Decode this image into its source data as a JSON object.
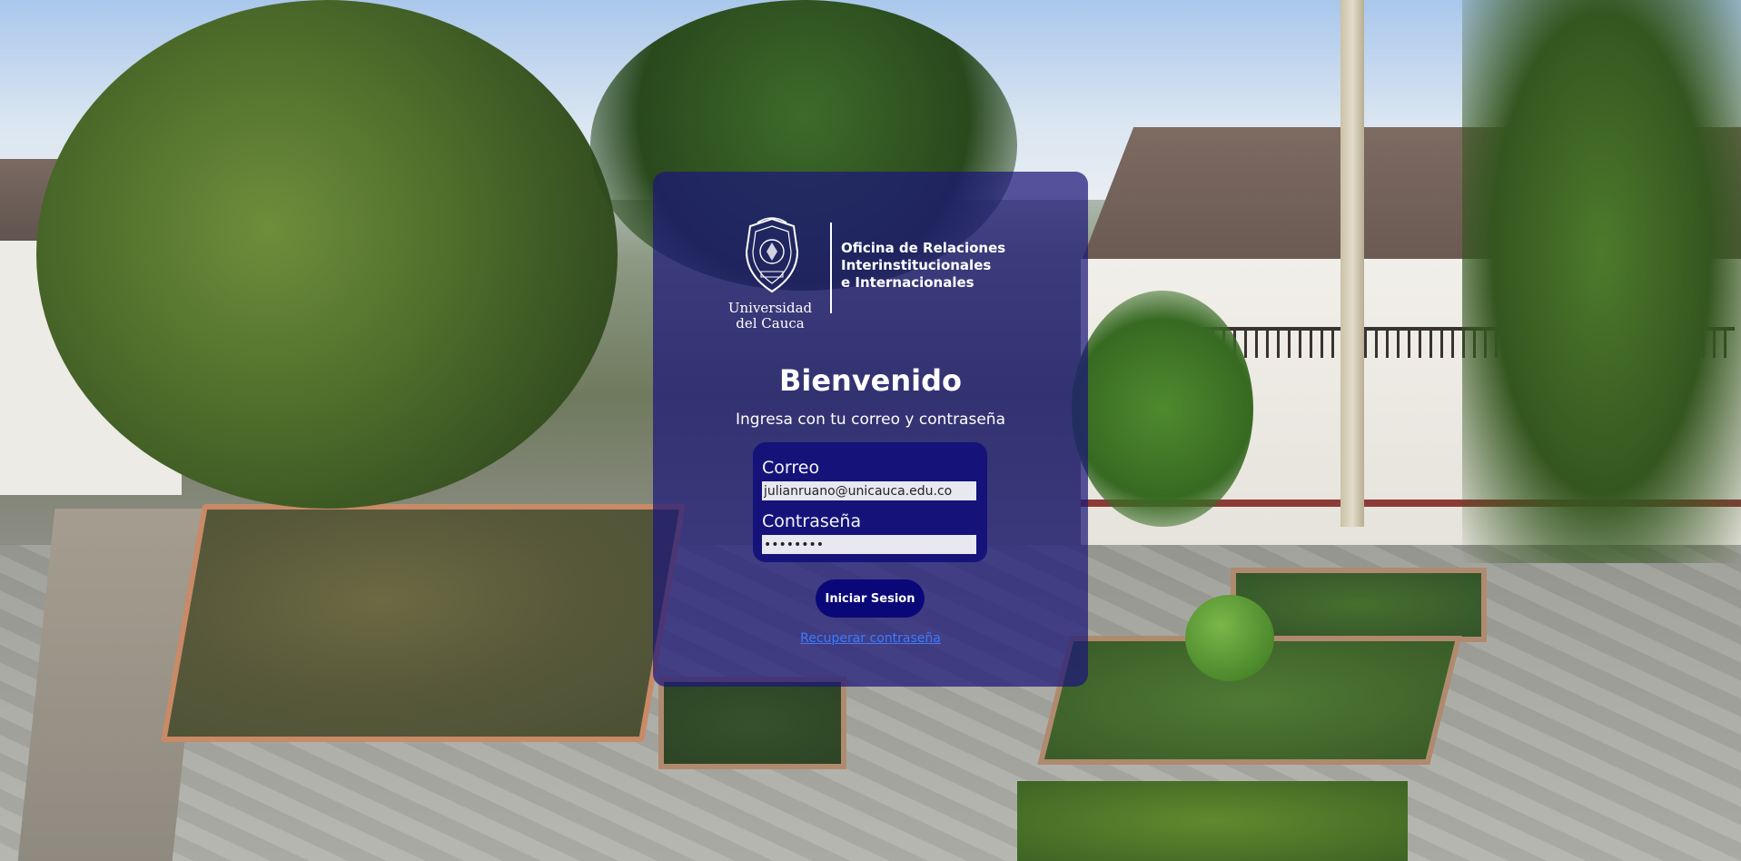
{
  "branding": {
    "university_name_line1": "Universidad",
    "university_name_line2": "del Cauca",
    "office_line1": "Oficina de Relaciones",
    "office_line2": "Interinstitucionales",
    "office_line3": "e Internacionales",
    "seal_icon": "university-seal-icon"
  },
  "login": {
    "title": "Bienvenido",
    "subtitle": "Ingresa con tu correo y contraseña",
    "email_label": "Correo",
    "email_value": "julianruano@unicauca.edu.co",
    "password_label": "Contraseña",
    "password_value": "••••••••",
    "submit_label": "Iniciar Sesion",
    "recover_label": "Recuperar contraseña"
  },
  "colors": {
    "card_overlay": "#1c1678",
    "form_box": "#14127a",
    "button": "#0a0878",
    "link": "#3a7bff"
  }
}
